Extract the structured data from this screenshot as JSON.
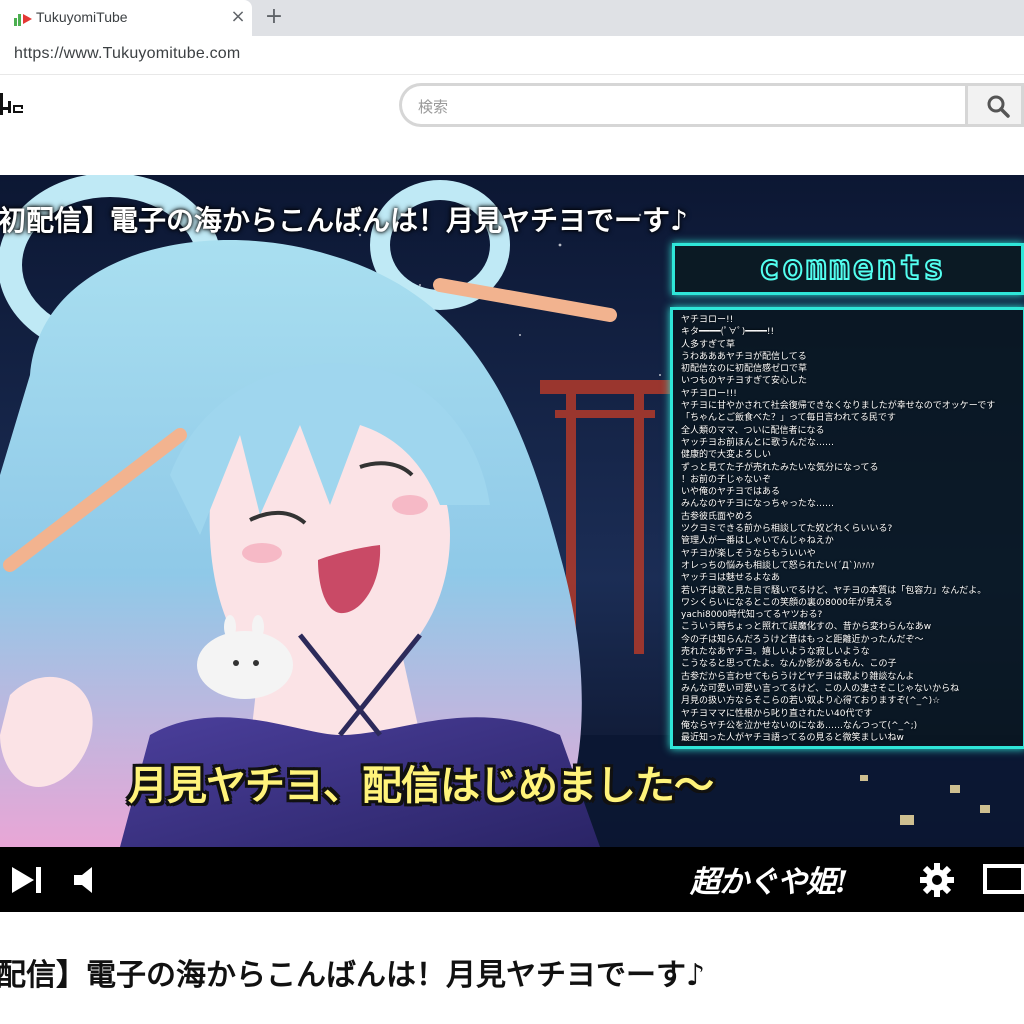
{
  "browser": {
    "tab_title": "TukuyomiTube",
    "tab_close": "×",
    "new_tab": "+",
    "url": "https://www.Tukuyomitube.com"
  },
  "site": {
    "logo_text": "be",
    "search": {
      "placeholder": "検索"
    }
  },
  "player": {
    "overlay_title": "初配信】電子の海からこんばんは！月見ヤチヨでーす♪",
    "comments_header": "comments",
    "comments": [
      "ヤチヨロー!!",
      "キタ━━━━(ﾟ∀ﾟ)━━━━!!",
      "人多すぎて草",
      "うわあああヤチヨが配信してる",
      "初配信なのに初配信感ゼロで草",
      "いつものヤチヨすぎて安心した",
      "ヤチヨロー!!!",
      "ヤチヨに甘やかされて社会復帰できなくなりましたが幸せなのでオッケーです",
      "「ちゃんとご飯食べた？」って毎日言われてる民です",
      "全人類のママ、ついに配信者になる",
      "ヤッチヨお前ほんとに歌うんだな……",
      "健康的で大変よろしい",
      "ずっと見てた子が売れたみたいな気分になってる",
      "！お前の子じゃないぞ",
      "いや俺のヤチヨではある",
      "みんなのヤチヨになっちゃったな……",
      "古参彼氏面やめろ",
      "ツクヨミできる前から相談してた奴どれくらいいる?",
      "管理人が一番はしゃいでんじゃねえか",
      "ヤチヨが楽しそうならもういいや",
      "オレっちの悩みも相談して怒られたい(´Д`)ﾊｧﾊｧ",
      "ヤッチヨは魅せるよなあ",
      "若い子は歌と見た目で騒いでるけど、ヤチヨの本質は「包容力」なんだよ。",
      "ワシくらいになるとこの笑顔の裏の8000年が見える",
      "yachi8000時代知ってるヤツおる?",
      "こういう時ちょっと照れて誤魔化すの、昔から変わらんなあw",
      "今の子は知らんだろうけど昔はもっと距離近かったんだぞ～",
      "売れたなあヤチヨ。嬉しいような寂しいような",
      "こうなると思ってたよ。なんか影があるもん、この子",
      "古参だから言わせてもらうけどヤチヨは歌より雑談なんよ",
      "みんな可愛い可愛い言ってるけど、この人の凄さそこじゃないからね",
      "月見の扱い方ならそこらの若い奴より心得ておりますぞ(^_^)☆",
      "ヤチヨママに性根から叱り直されたい40代です",
      "俺ならヤチ公を泣かせないのになあ……なんつって(^_^;)",
      "最近知った人がヤチヨ語ってるの見ると微笑ましいねw"
    ],
    "caption": "月見ヤチヨ、配信はじめました～",
    "brand_logo": "超かぐや姫!"
  },
  "page": {
    "video_title": "配信】電子の海からこんばんは！月見ヤチヨでーす♪"
  },
  "colors": {
    "neon": "#2fe6d8",
    "caption_yellow": "#fff37a",
    "control_bar": "#000000"
  },
  "icons": [
    "favicon-icon",
    "close-icon",
    "plus-icon",
    "search-icon",
    "skip-next-icon",
    "volume-icon",
    "settings-gear-icon",
    "fullscreen-icon"
  ]
}
